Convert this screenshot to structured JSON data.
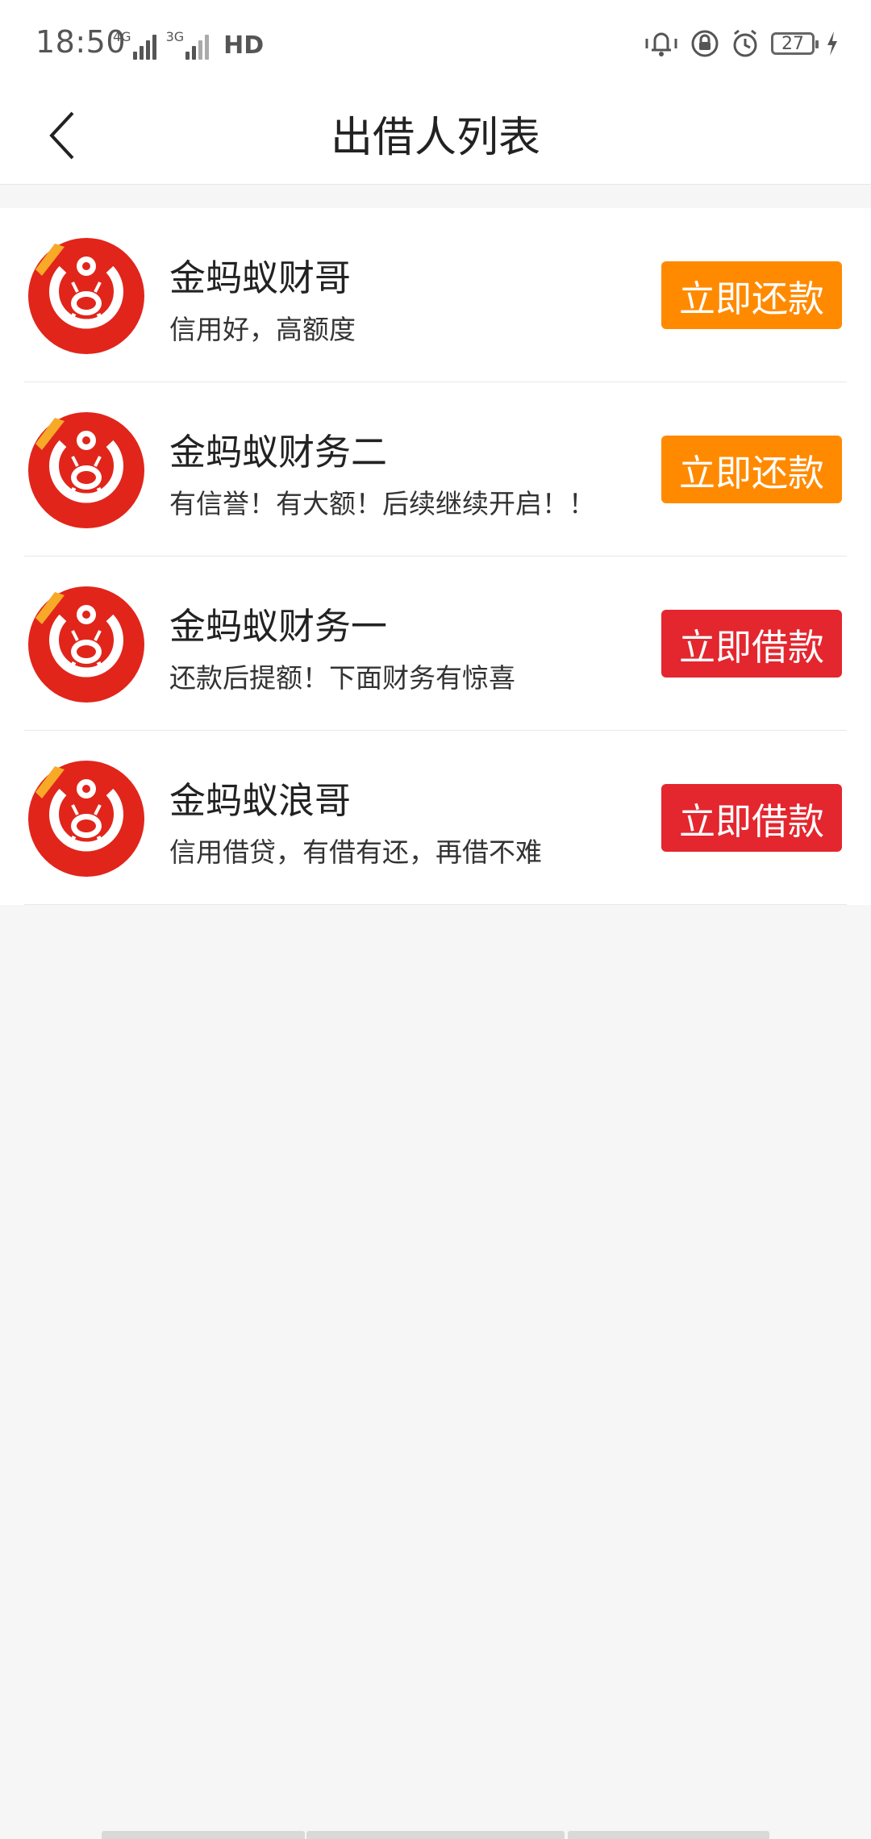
{
  "status_bar": {
    "time": "18:50",
    "net1": "4G",
    "net2": "3G",
    "hd": "HD",
    "battery": "27"
  },
  "header": {
    "title": "出借人列表"
  },
  "lenders": [
    {
      "name": "金蚂蚁财哥",
      "desc": "信用好，高额度",
      "button": "立即还款",
      "button_color": "#ff8a00"
    },
    {
      "name": "金蚂蚁财务二",
      "desc": "有信誉！有大额！后续继续开启！！",
      "button": "立即还款",
      "button_color": "#ff8a00"
    },
    {
      "name": "金蚂蚁财务一",
      "desc": "还款后提额！下面财务有惊喜",
      "button": "立即借款",
      "button_color": "#e4262e"
    },
    {
      "name": "金蚂蚁浪哥",
      "desc": "信用借贷，有借有还，再借不难",
      "button": "立即借款",
      "button_color": "#e4262e"
    }
  ],
  "colors": {
    "logo_red": "#e1251b",
    "repay_orange": "#ff8a00",
    "borrow_red": "#e4262e"
  },
  "icons": {
    "back": "chevron-left-icon",
    "logo": "gold-ant-logo-icon"
  }
}
